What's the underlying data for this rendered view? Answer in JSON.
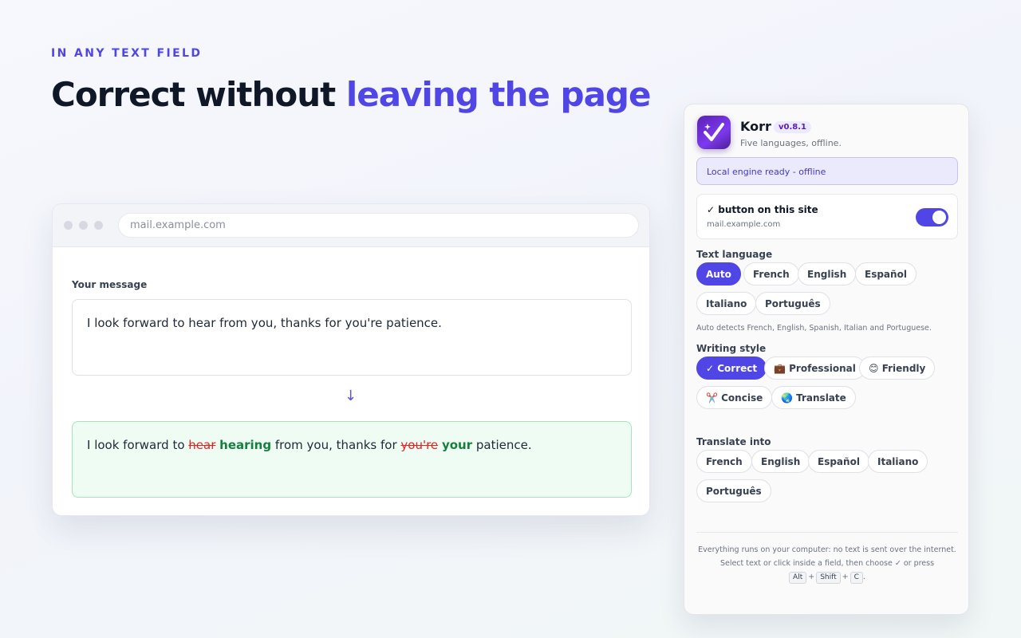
{
  "hero": {
    "eyebrow": "IN ANY TEXT FIELD",
    "title_plain": "Correct without ",
    "title_accent": "leaving the page"
  },
  "browser": {
    "url": "mail.example.com",
    "field_label": "Your message",
    "input_text": "I look forward to hear from you, thanks for you're patience.",
    "arrow": "↓",
    "result": {
      "part1": "I look forward to ",
      "removed1": "hear",
      "added1": "hearing",
      "part2": " from you, thanks for ",
      "removed2": "you're",
      "added2": "your",
      "part3": " patience."
    }
  },
  "panel": {
    "app_name": "Korr",
    "version": "v0.8.1",
    "tagline": "Five languages, offline.",
    "status": "Local engine ready - offline",
    "site_toggle": {
      "title": "✓ button on this site",
      "host": "mail.example.com",
      "enabled": true
    },
    "text_language": {
      "label": "Text language",
      "options": [
        "Auto",
        "French",
        "English",
        "Español",
        "Italiano",
        "Português"
      ],
      "selected": "Auto",
      "hint": "Auto detects French, English, Spanish, Italian and Portuguese."
    },
    "writing_style": {
      "label": "Writing style",
      "options": [
        "✓ Correct",
        "💼 Professional",
        "😊 Friendly",
        "✂️ Concise",
        "🌏 Translate"
      ],
      "selected": "✓ Correct"
    },
    "translate_into": {
      "label": "Translate into",
      "options": [
        "French",
        "English",
        "Español",
        "Italiano",
        "Português"
      ]
    },
    "footer": {
      "line1": "Everything runs on your computer: no text is sent over the internet.",
      "line2": "Select text or click inside a field, then choose ✓ or press",
      "keys": [
        "Alt",
        "Shift",
        "C"
      ],
      "end": "."
    }
  },
  "colors": {
    "accent": "#4f46e5",
    "deleted": "#dc2626",
    "inserted": "#15803d",
    "result_bg": "#effcf3"
  }
}
